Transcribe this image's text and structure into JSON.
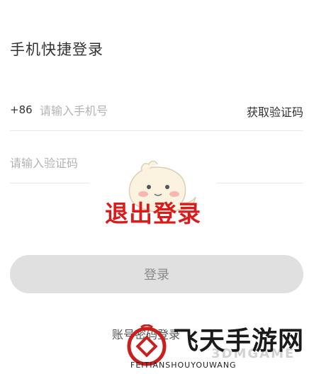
{
  "header": {
    "title": "手机快捷登录"
  },
  "phone_row": {
    "country_code": "+86",
    "placeholder": "请输入手机号",
    "get_code_label": "获取验证码"
  },
  "code_row": {
    "placeholder": "请输入验证码"
  },
  "overlay": {
    "text": "退出登录"
  },
  "login": {
    "button_label": "登录",
    "alt_login_label": "账号密码登录"
  },
  "watermark": {
    "text": "飞天手游网",
    "sub": "FEITIANSHOUYOUWANG",
    "brand": "3DMGAME"
  },
  "colors": {
    "overlay_red": "#d81b1b",
    "button_bg": "#e0e0e0",
    "placeholder": "#b3b3b3"
  }
}
